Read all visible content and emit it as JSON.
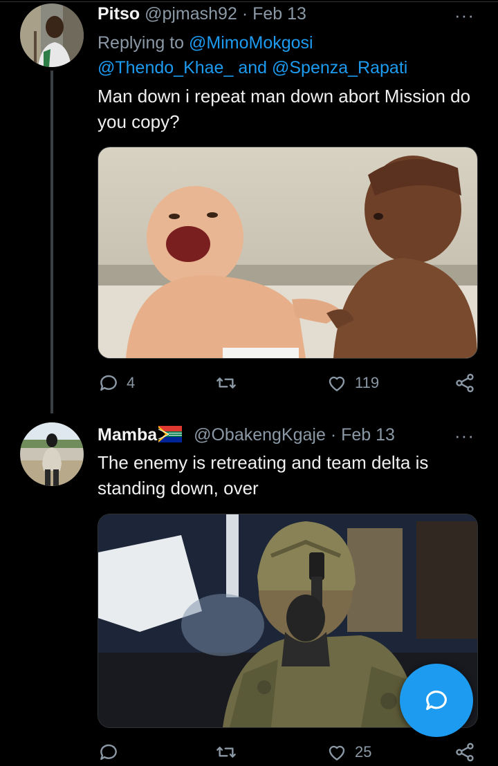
{
  "tweets": [
    {
      "name": "Pitso",
      "handle": "@pjmash92",
      "separator": "·",
      "date": "Feb 13",
      "replying_prefix": "Replying to ",
      "replying_user_1": "@MimoMokgosi",
      "replying_user_2": "@Thendo_Khae_",
      "replying_and": " and ",
      "replying_user_3": "@Spenza_Rapati",
      "text": "Man down i repeat man down abort Mission do you copy?",
      "reply_count": "4",
      "like_count": "119"
    },
    {
      "name": "Mamba",
      "handle": "@ObakengKgaje",
      "separator": "·",
      "date": "Feb 13",
      "text": "The enemy is retreating and team delta is standing down, over",
      "like_count": "25"
    }
  ],
  "more_label": "···",
  "colors": {
    "accent": "#1d9bf0",
    "background": "#000000",
    "muted": "#8b98a5"
  },
  "icons": [
    "reply-icon",
    "retweet-icon",
    "heart-icon",
    "share-icon",
    "more-icon",
    "compose-icon",
    "south-africa-flag-icon"
  ]
}
